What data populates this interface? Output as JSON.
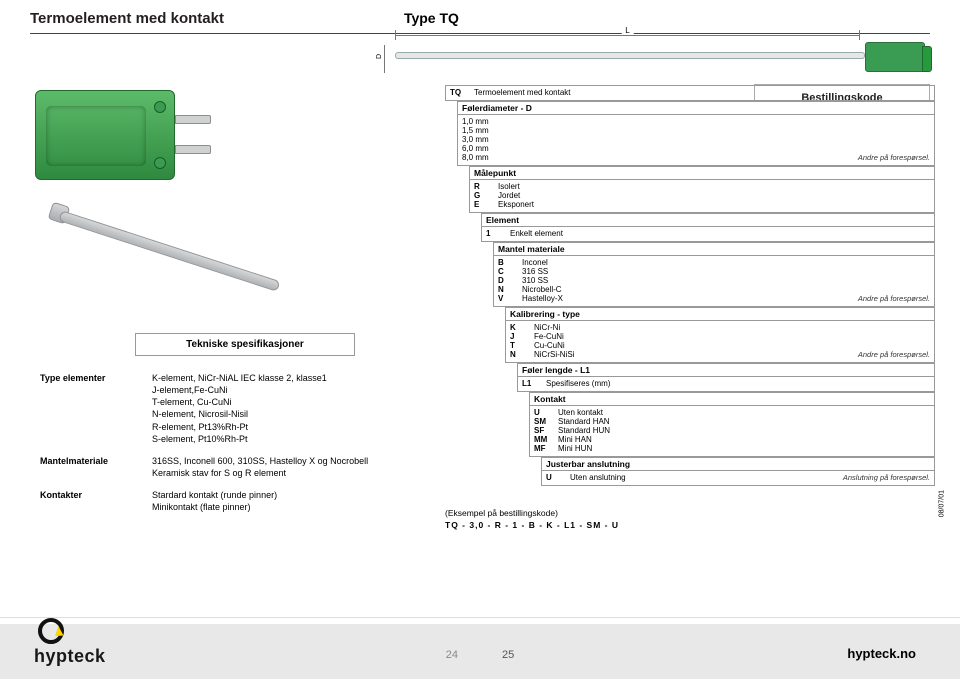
{
  "header": {
    "title": "Termoelement med kontakt",
    "type_label": "Type TQ",
    "bestillingskode": "Bestillingskode"
  },
  "diagram": {
    "length_label": "L",
    "diameter_label": "D"
  },
  "tech_spec_heading": "Tekniske spesifikasjoner",
  "specs": {
    "rows": [
      {
        "label": "Type elementer",
        "value": "K-element, NiCr-NiAL IEC klasse 2, klasse1\nJ-element,Fe-CuNi\nT-element, Cu-CuNi\nN-element, Nicrosil-Nisil\nR-element, Pt13%Rh-Pt\nS-element, Pt10%Rh-Pt"
      },
      {
        "label": "Mantelmateriale",
        "value": "316SS, Inconell 600, 310SS, Hastelloy X og Nocrobell\nKeramisk stav for S og R element"
      },
      {
        "label": "Kontakter",
        "value": "Stardard kontakt (runde pinner)\nMinikontakt (flate pinner)"
      }
    ]
  },
  "order": {
    "tq": {
      "code": "TQ",
      "text": "Termoelement med kontakt"
    },
    "diameter": {
      "title": "Følerdiameter - D",
      "options": [
        {
          "txt": "1,0 mm"
        },
        {
          "txt": "1,5 mm"
        },
        {
          "txt": "3,0 mm"
        },
        {
          "txt": "6,0 mm"
        },
        {
          "txt": "8,0 mm",
          "note": "Andre på forespørsel."
        }
      ]
    },
    "malepunkt": {
      "title": "Målepunkt",
      "options": [
        {
          "code": "R",
          "txt": "Isolert"
        },
        {
          "code": "G",
          "txt": "Jordet"
        },
        {
          "code": "E",
          "txt": "Eksponert"
        }
      ]
    },
    "element": {
      "title": "Element",
      "options": [
        {
          "code": "1",
          "txt": "Enkelt element"
        }
      ]
    },
    "mantel": {
      "title": "Mantel materiale",
      "options": [
        {
          "code": "B",
          "txt": "Inconel"
        },
        {
          "code": "C",
          "txt": "316 SS"
        },
        {
          "code": "D",
          "txt": "310 SS"
        },
        {
          "code": "N",
          "txt": "Nicrobell-C"
        },
        {
          "code": "V",
          "txt": "Hastelloy-X",
          "note": "Andre på forespørsel."
        }
      ]
    },
    "kalibrering": {
      "title": "Kalibrering - type",
      "options": [
        {
          "code": "K",
          "txt": "NiCr-Ni"
        },
        {
          "code": "J",
          "txt": "Fe-CuNi"
        },
        {
          "code": "T",
          "txt": "Cu-CuNi"
        },
        {
          "code": "N",
          "txt": "NiCrSi-NiSi",
          "note": "Andre på forespørsel."
        }
      ]
    },
    "foler": {
      "title": "Føler lengde - L1",
      "options": [
        {
          "code": "L1",
          "txt": "Spesifiseres (mm)"
        }
      ]
    },
    "kontakt": {
      "title": "Kontakt",
      "options": [
        {
          "code": "U",
          "txt": "Uten kontakt"
        },
        {
          "code": "SM",
          "txt": "Standard HAN"
        },
        {
          "code": "SF",
          "txt": "Standard HUN"
        },
        {
          "code": "MM",
          "txt": "Mini HAN"
        },
        {
          "code": "MF",
          "txt": "Mini HUN"
        }
      ]
    },
    "justerbar": {
      "title": "Justerbar anslutning",
      "options": [
        {
          "code": "U",
          "txt": "Uten anslutning",
          "note": "Anslutning på forespørsel."
        }
      ]
    }
  },
  "example": {
    "label": "(Eksempel på bestillingskode)",
    "code": "TQ  -  3,0  -  R  -  1  -  B  -  K  -  L1  -  SM - U"
  },
  "revision": "08/07/01",
  "footer": {
    "brand": "hypteck",
    "page_left": "24",
    "page_right": "25",
    "site": "hypteck.no"
  }
}
